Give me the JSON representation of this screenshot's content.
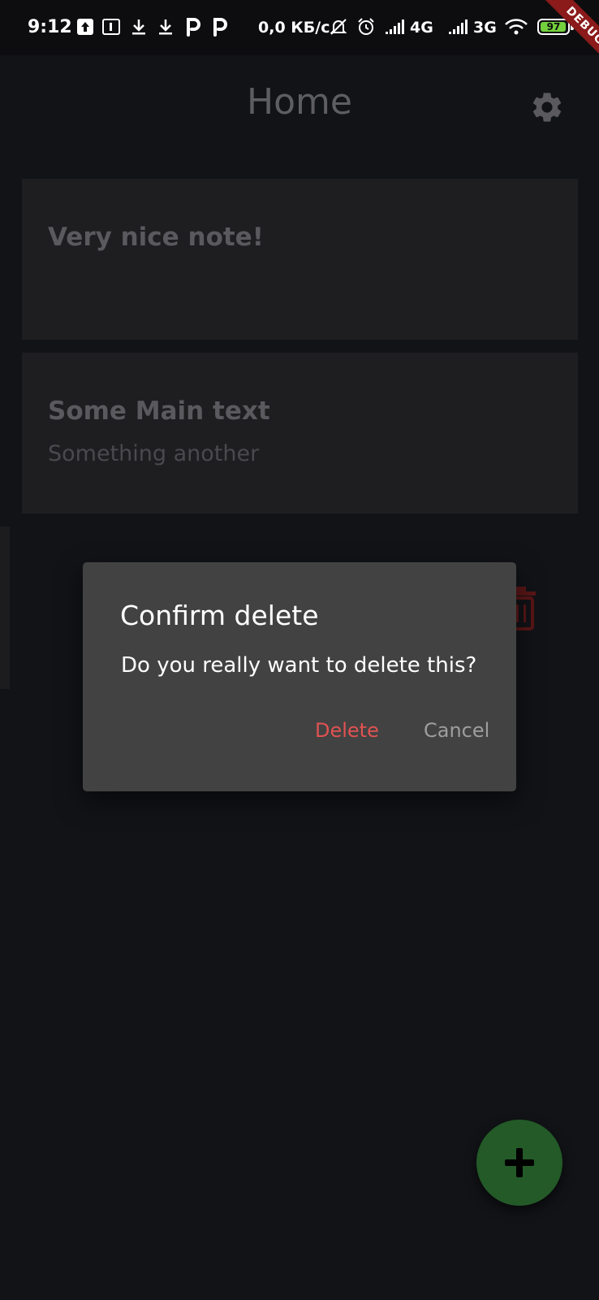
{
  "status_bar": {
    "time": "9:12",
    "speed": "0,0 КБ/с",
    "net1": "4G",
    "net2": "3G",
    "battery": "97",
    "debug": "DEBUG"
  },
  "app_bar": {
    "title": "Home"
  },
  "notes": [
    {
      "title": "Very nice note!",
      "body": ""
    },
    {
      "title": "Some Main text",
      "body": "Something another"
    }
  ],
  "dialog": {
    "title": "Confirm delete",
    "message": "Do you really want to delete this?",
    "delete_label": "Delete",
    "cancel_label": "Cancel"
  },
  "colors": {
    "background": "#121317",
    "card": "#1e1e20",
    "dialog": "#424242",
    "delete": "#e05252",
    "fab": "#235a28"
  },
  "icons": {
    "settings": "gear-icon",
    "fab": "plus-icon",
    "swipe_action": "trash-icon"
  }
}
